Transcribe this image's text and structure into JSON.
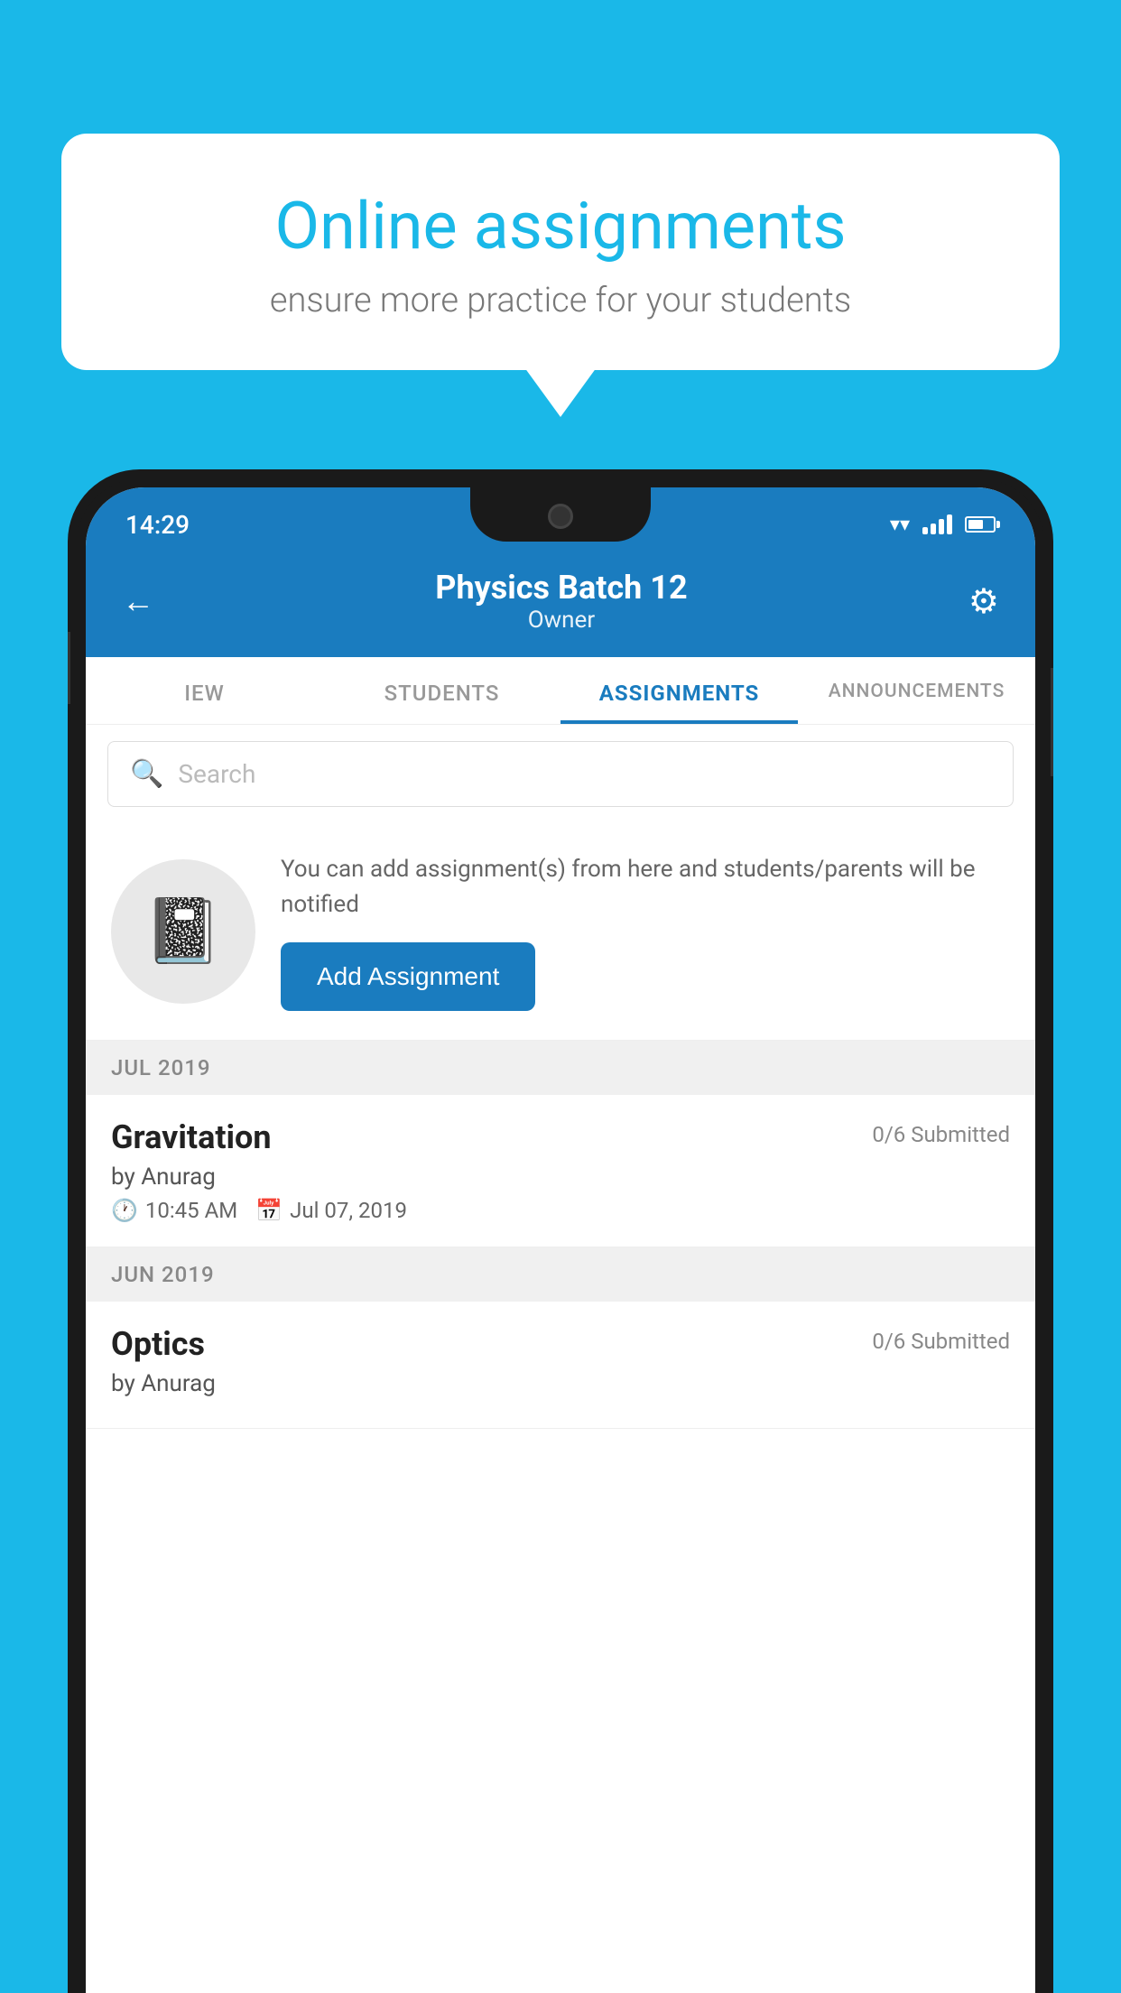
{
  "background_color": "#1ab8e8",
  "speech_bubble": {
    "title": "Online assignments",
    "subtitle": "ensure more practice for your students"
  },
  "status_bar": {
    "time": "14:29"
  },
  "header": {
    "title": "Physics Batch 12",
    "subtitle": "Owner",
    "back_label": "←",
    "settings_label": "⚙"
  },
  "tabs": [
    {
      "label": "IEW",
      "active": false
    },
    {
      "label": "STUDENTS",
      "active": false
    },
    {
      "label": "ASSIGNMENTS",
      "active": true
    },
    {
      "label": "ANNOUNCEMENTS",
      "active": false
    }
  ],
  "search": {
    "placeholder": "Search"
  },
  "info_section": {
    "description": "You can add assignment(s) from here and students/parents will be notified",
    "button_label": "Add Assignment"
  },
  "sections": [
    {
      "label": "JUL 2019",
      "assignments": [
        {
          "name": "Gravitation",
          "submitted": "0/6 Submitted",
          "author": "by Anurag",
          "time": "10:45 AM",
          "date": "Jul 07, 2019"
        }
      ]
    },
    {
      "label": "JUN 2019",
      "assignments": [
        {
          "name": "Optics",
          "submitted": "0/6 Submitted",
          "author": "by Anurag",
          "time": "",
          "date": ""
        }
      ]
    }
  ]
}
